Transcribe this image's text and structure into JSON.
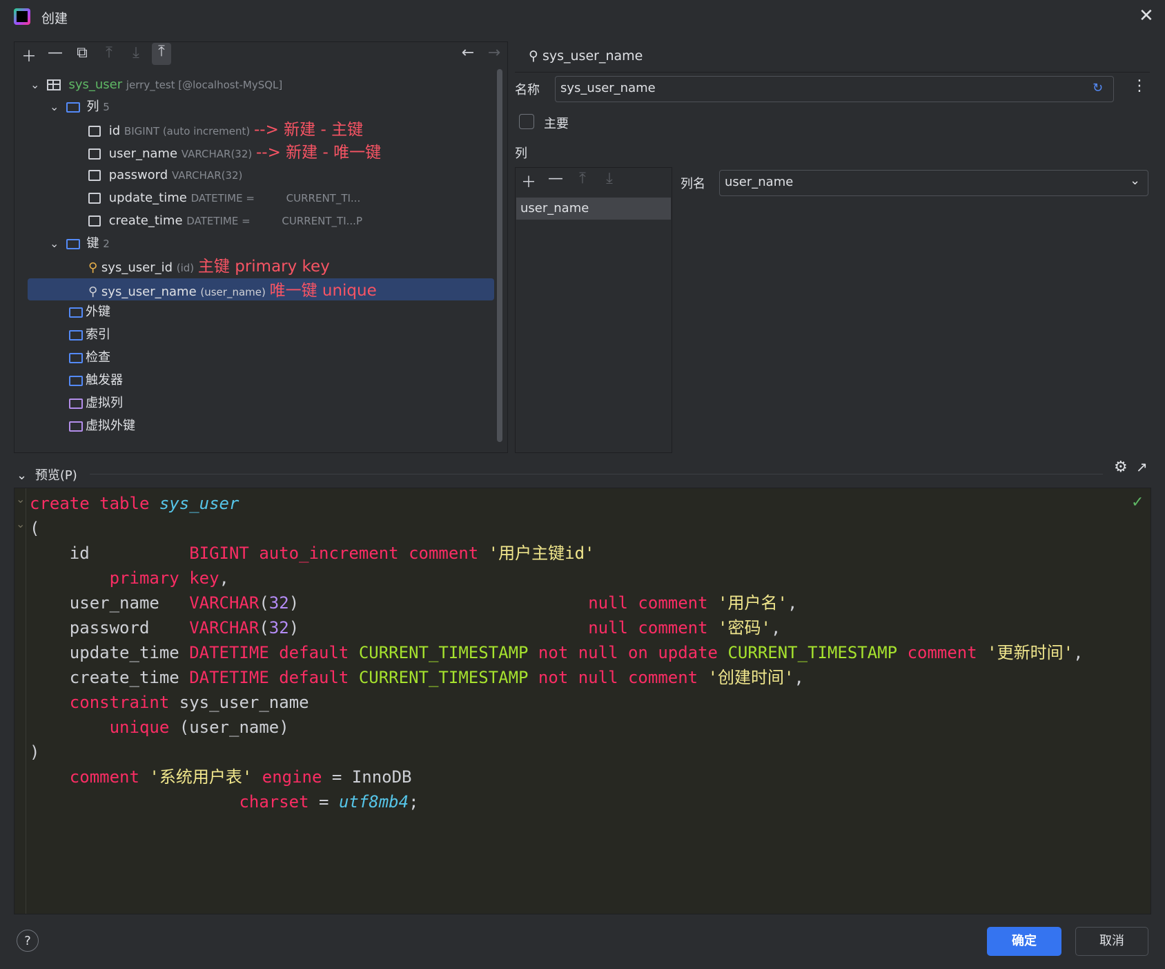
{
  "window": {
    "title": "创建"
  },
  "tree": {
    "table": {
      "name": "sys_user",
      "meta": "jerry_test [@localhost-MySQL]"
    },
    "columns_folder": {
      "label": "列",
      "count": "5"
    },
    "columns": [
      {
        "name": "id",
        "type": "BIGINT (auto increment)",
        "annotation": "--> 新建 - 主键"
      },
      {
        "name": "user_name",
        "type": "VARCHAR(32)",
        "annotation": "--> 新建 - 唯一键"
      },
      {
        "name": "password",
        "type": "VARCHAR(32)"
      },
      {
        "name": "update_time",
        "type": "DATETIME =",
        "default": "CURRENT_TI..."
      },
      {
        "name": "create_time",
        "type": "DATETIME =",
        "default": "CURRENT_TI...P"
      }
    ],
    "keys_folder": {
      "label": "键",
      "count": "2"
    },
    "keys": [
      {
        "name": "sys_user_id",
        "cols": "(id)",
        "annotation": "主键 primary key"
      },
      {
        "name": "sys_user_name",
        "cols": "(user_name)",
        "annotation": "唯一键 unique"
      }
    ],
    "other_folders": [
      "外键",
      "索引",
      "检查",
      "触发器"
    ],
    "virtual_folders": [
      "虚拟列",
      "虚拟外键"
    ]
  },
  "detail": {
    "header": "sys_user_name",
    "name_label": "名称",
    "name_value": "sys_user_name",
    "primary_label": "主要",
    "columns_label": "列",
    "column_list": [
      "user_name"
    ],
    "column_name_label": "列名",
    "column_name_value": "user_name"
  },
  "preview": {
    "label": "预览(P)",
    "sql_lines": [
      [
        [
          "kw",
          "create table "
        ],
        [
          "it",
          "sys_user"
        ]
      ],
      [
        [
          "id",
          "("
        ]
      ],
      [
        [
          "id",
          "    id          "
        ],
        [
          "kw",
          "BIGINT auto_increment comment "
        ],
        [
          "str",
          "'用户主键id'"
        ]
      ],
      [
        [
          "id",
          "        "
        ],
        [
          "kw",
          "primary key"
        ],
        [
          "id",
          ","
        ]
      ],
      [
        [
          "id",
          "    user_name   "
        ],
        [
          "kw",
          "VARCHAR"
        ],
        [
          "id",
          "("
        ],
        [
          "num",
          "32"
        ],
        [
          "id",
          ")                             "
        ],
        [
          "kw",
          "null comment "
        ],
        [
          "str",
          "'用户名'"
        ],
        [
          "id",
          ","
        ]
      ],
      [
        [
          "id",
          "    password    "
        ],
        [
          "kw",
          "VARCHAR"
        ],
        [
          "id",
          "("
        ],
        [
          "num",
          "32"
        ],
        [
          "id",
          ")                             "
        ],
        [
          "kw",
          "null comment "
        ],
        [
          "str",
          "'密码'"
        ],
        [
          "id",
          ","
        ]
      ],
      [
        [
          "id",
          "    update_time "
        ],
        [
          "kw",
          "DATETIME default "
        ],
        [
          "fn",
          "CURRENT_TIMESTAMP "
        ],
        [
          "kw",
          "not null on update "
        ],
        [
          "fn",
          "CURRENT_TIMESTAMP "
        ],
        [
          "kw",
          "comment "
        ],
        [
          "str",
          "'更新时间'"
        ],
        [
          "id",
          ","
        ]
      ],
      [
        [
          "id",
          "    create_time "
        ],
        [
          "kw",
          "DATETIME default "
        ],
        [
          "fn",
          "CURRENT_TIMESTAMP "
        ],
        [
          "kw",
          "not null comment "
        ],
        [
          "str",
          "'创建时间'"
        ],
        [
          "id",
          ","
        ]
      ],
      [
        [
          "id",
          "    "
        ],
        [
          "kw",
          "constraint "
        ],
        [
          "id",
          "sys_user_name"
        ]
      ],
      [
        [
          "id",
          "        "
        ],
        [
          "kw",
          "unique "
        ],
        [
          "id",
          "(user_name)"
        ]
      ],
      [
        [
          "id",
          ")"
        ]
      ],
      [
        [
          "id",
          "    "
        ],
        [
          "kw",
          "comment "
        ],
        [
          "str",
          "'系统用户表' "
        ],
        [
          "kw",
          "engine "
        ],
        [
          "id",
          "= InnoDB"
        ]
      ],
      [
        [
          "id",
          "                     "
        ],
        [
          "kw",
          "charset "
        ],
        [
          "id",
          "= "
        ],
        [
          "it",
          "utf8mb4"
        ],
        [
          "id",
          ";"
        ]
      ]
    ]
  },
  "footer": {
    "ok_label": "确定",
    "cancel_label": "取消"
  },
  "colors": {
    "accent": "#3574f0",
    "selection": "#2e436e",
    "annotation": "#f75464"
  }
}
